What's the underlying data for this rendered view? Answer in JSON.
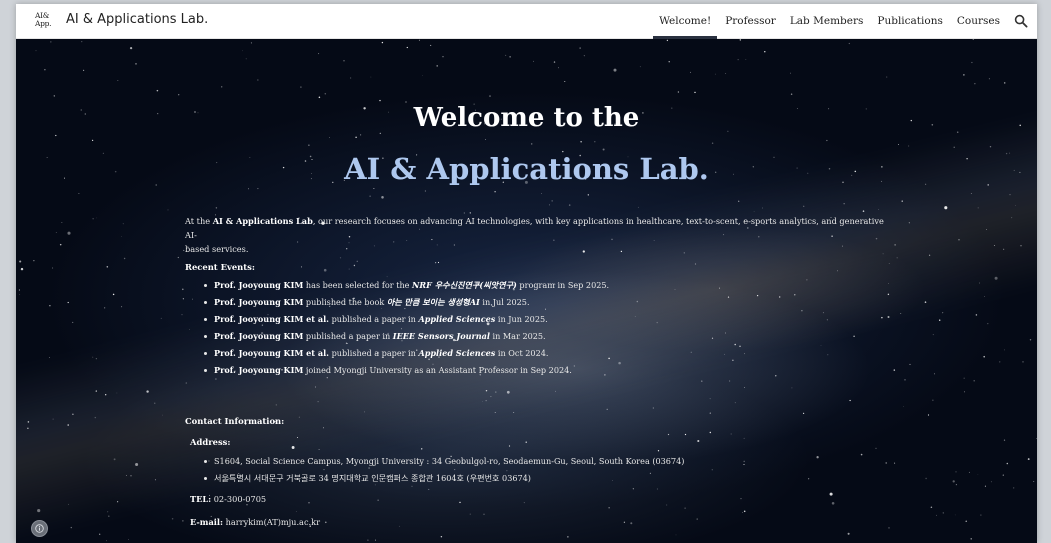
{
  "header": {
    "logo_line1": "AI&",
    "logo_line2": "App.",
    "site_title": "AI & Applications Lab.",
    "nav": [
      {
        "label": "Welcome!",
        "active": true
      },
      {
        "label": "Professor"
      },
      {
        "label": "Lab Members"
      },
      {
        "label": "Publications"
      },
      {
        "label": "Courses"
      }
    ],
    "search_icon": "search-icon"
  },
  "hero": {
    "title_line1": "Welcome to the",
    "title_line2": "AI & Applications Lab.",
    "intro_prefix": "At the ",
    "intro_lab": "AI & Applications Lab",
    "intro_rest": ", our research focuses on advancing AI technologies, with key applications in healthcare, text-to-scent, e-sports analytics, and generative AI-",
    "intro_line2": "based services.",
    "recent_events_label": "Recent Events:",
    "events": [
      {
        "bold": "Prof. Jooyoung KIM",
        "text": " has been selected for the ",
        "em": "NRF 우수신진연구(씨앗연구)",
        "tail": " program in Sep 2025."
      },
      {
        "bold": "Prof. Jooyoung KIM",
        "text": " published the book ",
        "em": "아는 만큼 보이는 생성형AI",
        "tail": " in Jul 2025."
      },
      {
        "bold": "Prof. Jooyoung KIM et al.",
        "text": " published a paper in ",
        "em": "Applied Sciences",
        "tail": " in Jun 2025."
      },
      {
        "bold": "Prof. Jooyoung KIM",
        "text": " published a paper in ",
        "em": "IEEE Sensors Journal",
        "tail": " in Mar 2025."
      },
      {
        "bold": "Prof. Jooyoung KIM et al.",
        "text": " published a paper in ",
        "em": "Applied Sciences",
        "tail": " in Oct 2024."
      },
      {
        "bold": "Prof. Jooyoung KIM",
        "text": " joined Myongji University as an Assistant Professor in Sep 2024.",
        "em": "",
        "tail": ""
      }
    ],
    "contact_label": "Contact Information:",
    "address_label": "Address:",
    "addresses": [
      "S1604, Social Science Campus, Myongji University : 34 Geobulgol-ro, Seodaemun-Gu, Seoul, South Korea (03674)",
      "서울특별시 서대문구 거북골로 34 명지대학교 인문캠퍼스 종합관 1604호 (우편번호 03674)"
    ],
    "tel_label": "TEL:",
    "tel_value": " 02-300-0705",
    "email_label": "E-mail:",
    "email_value": " harrykim(AT)mju.ac.kr"
  },
  "colors": {
    "title_white": "#ffffff",
    "title_blue": "#aec8ef",
    "nav_active_underline": "#2a3140",
    "hero_background": "#050a16"
  },
  "info_icon": "info-icon"
}
